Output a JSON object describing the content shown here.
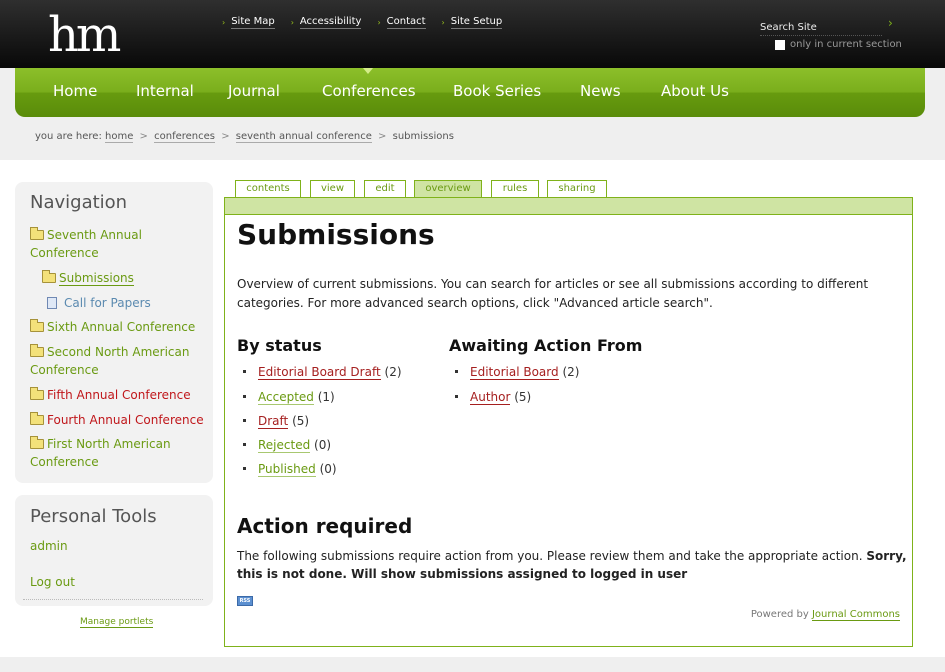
{
  "header": {
    "logo": "hm",
    "site_links": [
      {
        "label": "Site Map"
      },
      {
        "label": "Accessibility"
      },
      {
        "label": "Contact"
      },
      {
        "label": "Site Setup"
      }
    ],
    "search_placeholder": "Search Site",
    "search_go_glyph": "›",
    "section_only_label": "only in current section"
  },
  "nav": {
    "items": [
      "Home",
      "Internal",
      "Journal",
      "Conferences",
      "Book Series",
      "News",
      "About Us"
    ],
    "selected": "Conferences"
  },
  "breadcrumb": {
    "prefix": "you are here:",
    "links": [
      "home",
      "conferences",
      "seventh annual conference"
    ],
    "current": "submissions",
    "separator": ">"
  },
  "sidebar": {
    "navigation": {
      "title": "Navigation",
      "items": [
        {
          "label": "Seventh Annual",
          "label2": "Conference"
        },
        {
          "label": "Submissions"
        },
        {
          "label": "Call for Papers"
        },
        {
          "label": "Sixth Annual Conference"
        },
        {
          "label": "Second North American",
          "label2": "Conference"
        },
        {
          "label": "Fifth Annual Conference"
        },
        {
          "label": "Fourth Annual Conference"
        },
        {
          "label": "First North American",
          "label2": "Conference"
        }
      ]
    },
    "personal_tools": {
      "title": "Personal Tools",
      "items": [
        "admin",
        "Log out"
      ]
    },
    "manage_portlets": "Manage portlets"
  },
  "tabs": [
    "contents",
    "view",
    "edit",
    "overview",
    "rules",
    "sharing"
  ],
  "active_tab": "overview",
  "content": {
    "title": "Submissions",
    "description": "Overview of current submissions. You can search for articles or see all submissions according to different categories. For more advanced search options, click \"Advanced article search\".",
    "by_status": {
      "heading": "By status",
      "items": [
        {
          "label": "Editorial Board Draft",
          "count": "(2)"
        },
        {
          "label": "Accepted",
          "count": "(1)"
        },
        {
          "label": "Draft",
          "count": "(5)"
        },
        {
          "label": "Rejected",
          "count": "(0)"
        },
        {
          "label": "Published",
          "count": "(0)"
        }
      ]
    },
    "awaiting": {
      "heading": "Awaiting Action From",
      "items": [
        {
          "label": "Editorial Board",
          "count": "(2)"
        },
        {
          "label": "Author",
          "count": "(5)"
        }
      ]
    },
    "action_required": {
      "heading": "Action required",
      "text": "The following submissions require action from you. Please review them and take the appropriate action.",
      "bold_text": "Sorry, this is not done. Will show submissions assigned to logged in user"
    },
    "rss_label": "RSS",
    "powered_by": "Powered by",
    "powered_link": "Journal Commons"
  }
}
